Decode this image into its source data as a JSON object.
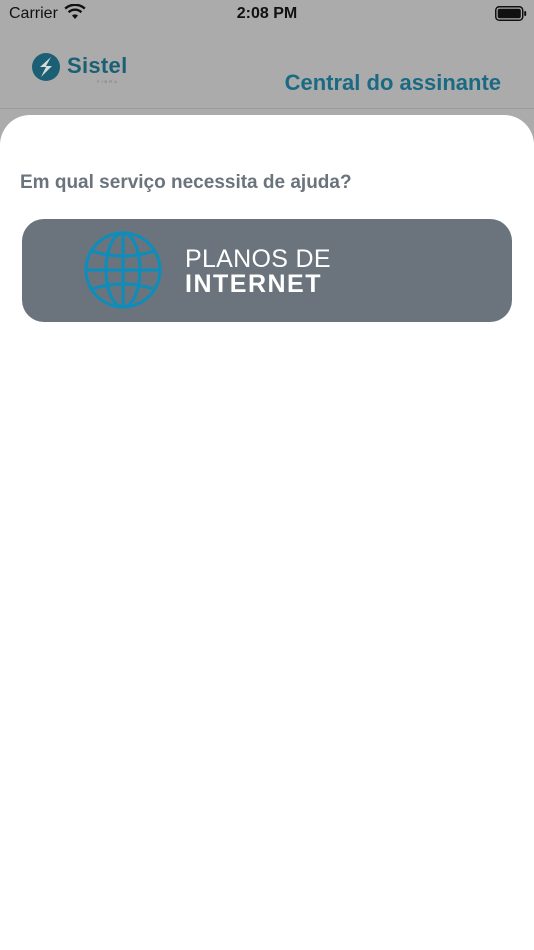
{
  "status_bar": {
    "carrier": "Carrier",
    "time": "2:08 PM"
  },
  "header": {
    "logo_text": "Sistel",
    "logo_subtext": "FIBRA",
    "title": "Central do assinante"
  },
  "sheet": {
    "question": "Em qual serviço necessita de ajuda?",
    "services": [
      {
        "line1": "PLANOS DE",
        "line2": "INTERNET",
        "icon": "globe-icon"
      }
    ]
  },
  "colors": {
    "overlay": "#ababab",
    "brand_blue": "#1b6a84",
    "card_gray": "#6b747c",
    "globe_blue": "#0f8dba",
    "text_gray": "#6b747c"
  }
}
